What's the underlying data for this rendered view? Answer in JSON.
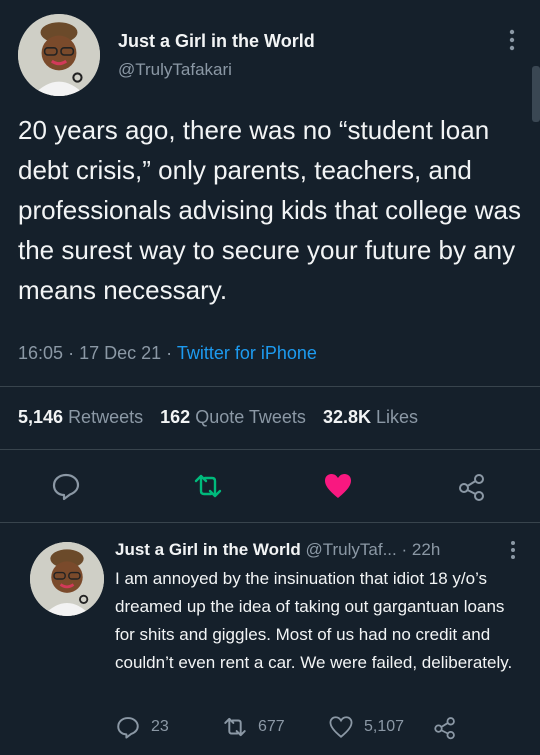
{
  "colors": {
    "background": "#15202b",
    "accent": "#1d9bf0",
    "retweet_green": "#00ba7c",
    "like_pink": "#f91880",
    "muted": "#8b98a5"
  },
  "tweet": {
    "author_name": "Just a Girl in the World",
    "handle": "@TrulyTafakari",
    "text": "20 years ago, there was no “student loan debt crisis,” only parents, teachers, and professionals advising kids that college was the surest way to secure your future by any means necessary.",
    "time": "16:05",
    "date": "17 Dec 21",
    "source": "Twitter for iPhone",
    "stats": {
      "retweets_count": "5,146",
      "retweets_label": "Retweets",
      "quotes_count": "162",
      "quotes_label": "Quote Tweets",
      "likes_count": "32.8K",
      "likes_label": "Likes"
    },
    "actions": [
      "reply-icon",
      "retweet-icon",
      "heart-icon-filled",
      "share-icon"
    ]
  },
  "reply": {
    "author_name": "Just a Girl in the World",
    "handle": "@TrulyTaf...",
    "age": "22h",
    "text": "I am annoyed by the insinuation that idiot 18 y/o’s dreamed up the idea of taking out gargantuan loans for shits and giggles. Most of us had no credit and couldn’t even rent a car. We were failed, deliberately.",
    "replies": "23",
    "retweets": "677",
    "likes": "5,107"
  }
}
